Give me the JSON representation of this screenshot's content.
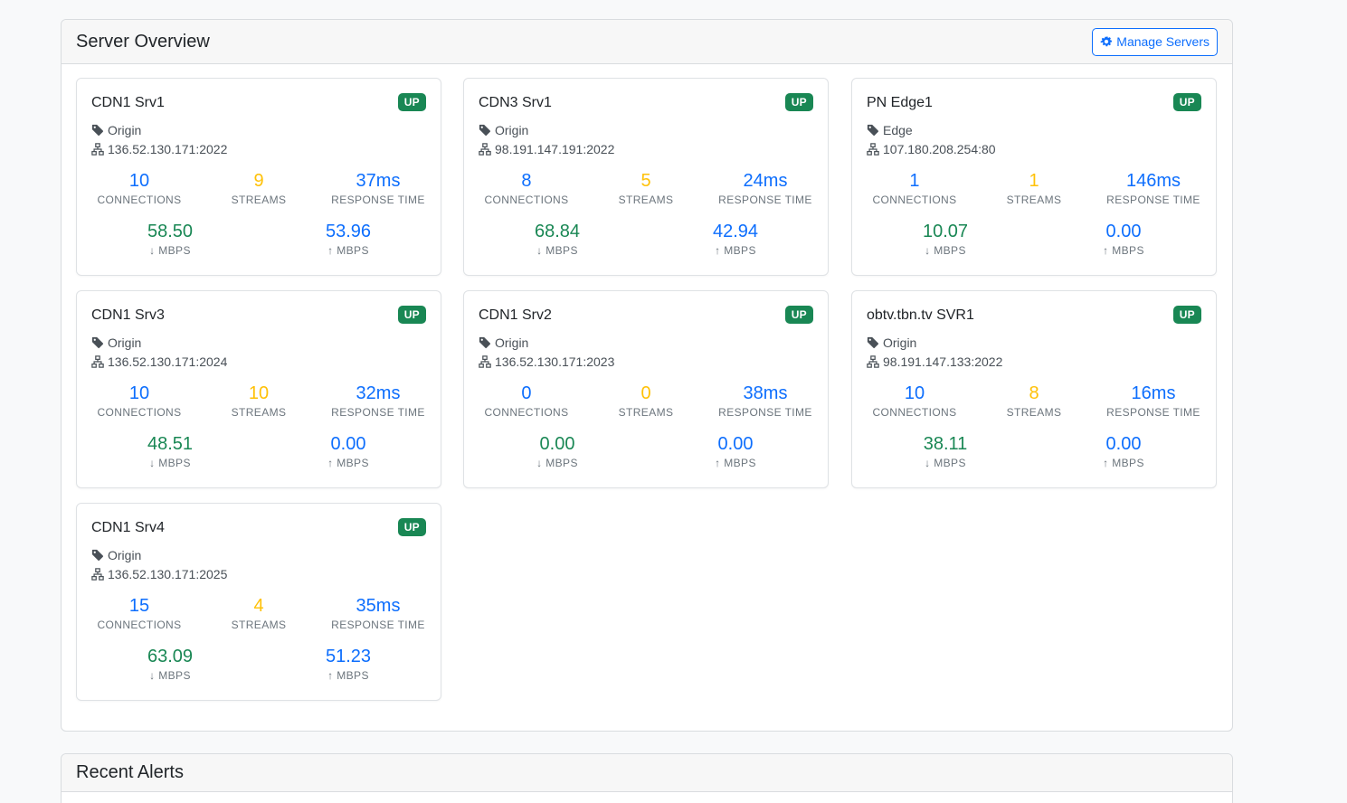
{
  "overview": {
    "title": "Server Overview",
    "manage_label": "Manage Servers",
    "servers": [
      {
        "name": "CDN1 Srv1",
        "status": "UP",
        "type": "Origin",
        "address": "136.52.130.171:2022",
        "connections": "10",
        "streams": "9",
        "response": "37ms",
        "down": "58.50",
        "up": "53.96"
      },
      {
        "name": "CDN3 Srv1",
        "status": "UP",
        "type": "Origin",
        "address": "98.191.147.191:2022",
        "connections": "8",
        "streams": "5",
        "response": "24ms",
        "down": "68.84",
        "up": "42.94"
      },
      {
        "name": "PN Edge1",
        "status": "UP",
        "type": "Edge",
        "address": "107.180.208.254:80",
        "connections": "1",
        "streams": "1",
        "response": "146ms",
        "down": "10.07",
        "up": "0.00"
      },
      {
        "name": "CDN1 Srv3",
        "status": "UP",
        "type": "Origin",
        "address": "136.52.130.171:2024",
        "connections": "10",
        "streams": "10",
        "response": "32ms",
        "down": "48.51",
        "up": "0.00"
      },
      {
        "name": "CDN1 Srv2",
        "status": "UP",
        "type": "Origin",
        "address": "136.52.130.171:2023",
        "connections": "0",
        "streams": "0",
        "response": "38ms",
        "down": "0.00",
        "up": "0.00"
      },
      {
        "name": "obtv.tbn.tv SVR1",
        "status": "UP",
        "type": "Origin",
        "address": "98.191.147.133:2022",
        "connections": "10",
        "streams": "8",
        "response": "16ms",
        "down": "38.11",
        "up": "0.00"
      },
      {
        "name": "CDN1 Srv4",
        "status": "UP",
        "type": "Origin",
        "address": "136.52.130.171:2025",
        "connections": "15",
        "streams": "4",
        "response": "35ms",
        "down": "63.09",
        "up": "51.23"
      }
    ]
  },
  "labels": {
    "connections": "CONNECTIONS",
    "streams": "STREAMS",
    "response": "RESPONSE TIME",
    "down": "↓ MBPS",
    "up": "↑ MBPS"
  },
  "alerts": {
    "title": "Recent Alerts"
  },
  "colors": {
    "primary": "#0d6efd",
    "success": "#198754",
    "warning": "#ffc107"
  },
  "icons": {
    "manage": "gear-icon",
    "type": "tag-icon",
    "address": "network-icon"
  }
}
